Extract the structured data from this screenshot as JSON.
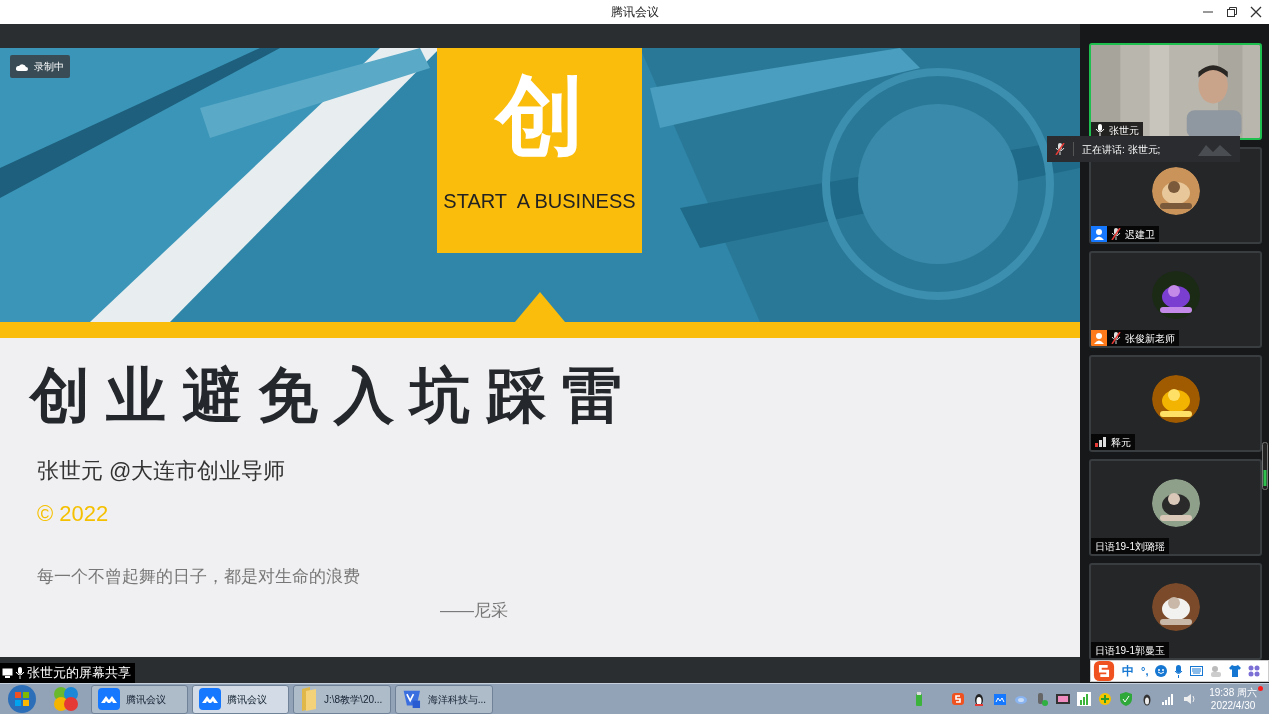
{
  "window": {
    "title": "腾讯会议"
  },
  "recording_badge": {
    "label": "录制中"
  },
  "slide": {
    "logo_char": "创",
    "logo_caption": "START  A BUSINESS",
    "title": "创业避免入坑踩雷",
    "author": "张世元 @大连市创业导师",
    "copyright": "© 2022",
    "quote": "每一个不曾起舞的日子，都是对生命的浪费",
    "quote_source": "——尼采"
  },
  "speaker_toast": {
    "text": "正在讲话: 张世元;"
  },
  "participants": [
    {
      "name": "张世元",
      "kind": "video",
      "muted": false,
      "speaking": true
    },
    {
      "name": "迟建卫",
      "kind": "avatar",
      "muted": true,
      "speaking": false,
      "color": "#1677ff"
    },
    {
      "name": "张俊新老师",
      "kind": "avatar",
      "muted": true,
      "speaking": false,
      "color": "#ff7a1a"
    },
    {
      "name": "释元",
      "kind": "avatar",
      "weak_signal": true,
      "speaking": false
    },
    {
      "name": "日语19-1刘璐瑶",
      "kind": "avatar",
      "speaking": false
    },
    {
      "name": "日语19-1郭曼玉",
      "kind": "avatar",
      "speaking": false
    }
  ],
  "share_label": {
    "text": "张世元的屏幕共享"
  },
  "ime_toolbar": {
    "mode": "中",
    "punctuation": "°,"
  },
  "taskbar": {
    "items": [
      {
        "label": "腾讯会议",
        "kind": "meeting",
        "selected": false
      },
      {
        "label": "腾讯会议",
        "kind": "meeting",
        "selected": true
      },
      {
        "label": "J:\\8教学\\20...",
        "kind": "folder",
        "selected": false
      },
      {
        "label": "海洋科技与...",
        "kind": "document",
        "selected": false
      }
    ],
    "clock": {
      "time": "19:38 周六",
      "date": "2022/4/30"
    }
  }
}
